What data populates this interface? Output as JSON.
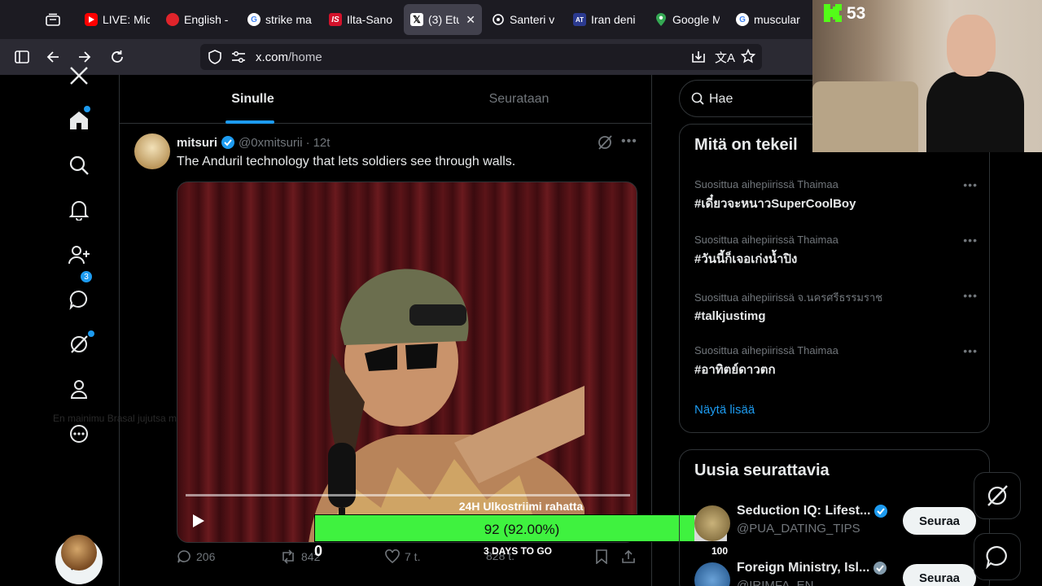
{
  "browser": {
    "tabs": [
      {
        "title": "LIVE: Mic",
        "icon": "youtube-icon",
        "color": "#ff0000"
      },
      {
        "title": "English -",
        "icon": "red-globe-icon",
        "color": "#e0242b"
      },
      {
        "title": "strike ma",
        "icon": "google-icon",
        "color": "#4285f4"
      },
      {
        "title": "Ilta-Sano",
        "icon": "iltasanomat-icon",
        "color": "#d3122b"
      },
      {
        "title": "(3) Etu",
        "icon": "x-icon",
        "color": "#000000",
        "active": true
      },
      {
        "title": "Santeri v",
        "icon": "openai-icon",
        "color": "#ffffff"
      },
      {
        "title": "Iran deni",
        "icon": "news-icon",
        "color": "#2b3a8f"
      },
      {
        "title": "Google M",
        "icon": "maps-icon",
        "color": "#34a853"
      },
      {
        "title": "muscular",
        "icon": "google-icon",
        "color": "#4285f4"
      }
    ],
    "url_main": "x.com",
    "url_path": "/home"
  },
  "nav": {
    "notifications_badge": "3",
    "ghost_text": "En mainimu Brasal jujutsa mitä hyl harjoitsen"
  },
  "timeline": {
    "tabs": [
      "Sinulle",
      "Seurataan"
    ],
    "tweet": {
      "name": "mitsuri",
      "handle": "@0xmitsurii",
      "time": "12t",
      "text": "The Anduril technology that lets soldiers see through walls.",
      "replies": "206",
      "reposts": "842",
      "likes": "7 t.",
      "views": "828 t."
    }
  },
  "poll": {
    "title": "24H Ulkostriimi rahatta",
    "value_text": "92 (92.00%)",
    "progress": 0.92,
    "min": "0",
    "max": "100",
    "days_text": "3 DAYS TO GO"
  },
  "sidebar": {
    "search_placeholder": "Hae",
    "trends_title": "Mitä on tekeil",
    "trends": [
      {
        "context": "Suosittua aihepiirissä Thaimaa",
        "tag": "#เดี๋ยวจะหนาวSuperCoolBoy"
      },
      {
        "context": "Suosittua aihepiirissä Thaimaa",
        "tag": "#วันนี้ก็เจอเก่งน้ำปิง"
      },
      {
        "context": "Suosittua aihepiirissä จ.นครศรีธรรมราช",
        "tag": "#talkjustimg"
      },
      {
        "context": "Suosittua aihepiirissä Thaimaa",
        "tag": "#อาทิตย์ดาวตก"
      }
    ],
    "show_more": "Näytä lisää",
    "follow_title": "Uusia seurattavia",
    "accounts": [
      {
        "name": "Seduction IQ: Lifest...",
        "handle": "@PUA_DATING_TIPS",
        "button": "Seuraa"
      },
      {
        "name": "Foreign Ministry, Isl...",
        "handle": "@IRIMFA_EN",
        "button": "Seuraa"
      }
    ]
  },
  "stream": {
    "viewers": "53",
    "accent": "#53fc18"
  }
}
